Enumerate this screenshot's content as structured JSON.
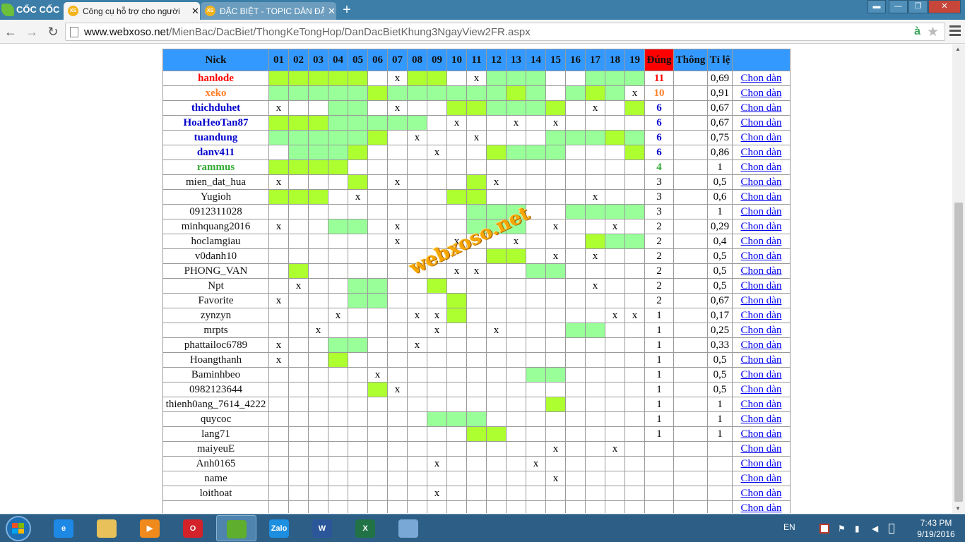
{
  "browser": {
    "brand": "CỐC CỐC",
    "tabs": [
      {
        "label": "Công cụ hỗ trợ cho người",
        "favicon": "XS"
      },
      {
        "label": "ĐẶC BIỆT - TOPIC DÀN ĐẶ",
        "favicon": "XS"
      }
    ],
    "new_tab": "+",
    "url_host": "www.webxoso.net",
    "url_path": "/MienBac/DacBiet/ThongKeTongHop/DanDacBietKhung3NgayView2FR.aspx"
  },
  "table": {
    "headers": {
      "nick": "Nick",
      "days": [
        "01",
        "02",
        "03",
        "04",
        "05",
        "06",
        "07",
        "08",
        "09",
        "10",
        "11",
        "12",
        "13",
        "14",
        "15",
        "16",
        "17",
        "18",
        "19"
      ],
      "dung": "Đúng",
      "thong": "Thông",
      "tile": "Tỉ lệ"
    },
    "link_label": "Chon dàn",
    "rows": [
      {
        "nick": "hanlode",
        "color": "#ff0000",
        "cells": "bbbbb.xbb.xaaa..aaaaa",
        "dung": "11",
        "tile": "0,69"
      },
      {
        "nick": "xeko",
        "color": "#ff7f27",
        "cells": "aaaaabaaaaaaba.abax..",
        "dung": "10",
        "tile": "0,91"
      },
      {
        "nick": "thichduhet",
        "color": "#0000cc",
        "cells": "x..aa.x..bbaaab.x.bb",
        "dung": "6",
        "tile": "0,67"
      },
      {
        "nick": "HoaHeoTan87",
        "color": "#0000cc",
        "cells": "bbbaaaaa.x..x.x......",
        "dung": "6",
        "tile": "0,67"
      },
      {
        "nick": "tuandung",
        "color": "#0000cc",
        "cells": "aaaaab.x..x...aaabaaa",
        "dung": "6",
        "tile": "0,75"
      },
      {
        "nick": "danv411",
        "color": "#0000cc",
        "cells": ".aaab...x..baaa...bb.",
        "dung": "6",
        "tile": "0,86"
      },
      {
        "nick": "rammus",
        "color": "#33aa33",
        "cells": "bbbb...............",
        "dung": "4",
        "tile": "1"
      },
      {
        "nick": "mien_dat_hua",
        "color": "#111111",
        "cells": "x...b.x...bx.........",
        "dung": "3",
        "tile": "0,5"
      },
      {
        "nick": "Yugioh",
        "color": "#111111",
        "cells": "bbb.x....bb.....x....",
        "dung": "3",
        "tile": "0,6"
      },
      {
        "nick": "0912311028",
        "color": "#111111",
        "cells": "..........aaa..aaaaa",
        "dung": "3",
        "tile": "1"
      },
      {
        "nick": "minhquang2016",
        "color": "#111111",
        "cells": "x..aa.x...aaa.x..x.x.",
        "dung": "2",
        "tile": "0,29"
      },
      {
        "nick": "hoclamgiau",
        "color": "#111111",
        "cells": "......x..x..x...baa..",
        "dung": "2",
        "tile": "0,4"
      },
      {
        "nick": "v0danh10",
        "color": "#111111",
        "cells": "...........bb.x.x....",
        "dung": "2",
        "tile": "0,5"
      },
      {
        "nick": "PHONG_VAN",
        "color": "#111111",
        "cells": ".b.......xx..aa......",
        "dung": "2",
        "tile": "0,5"
      },
      {
        "nick": "Npt",
        "color": "#111111",
        "cells": ".x..aa..b.......x....",
        "dung": "2",
        "tile": "0,5"
      },
      {
        "nick": "Favorite",
        "color": "#111111",
        "cells": "x...aa...b.........",
        "dung": "2",
        "tile": "0,67"
      },
      {
        "nick": "zynzyn",
        "color": "#111111",
        "cells": "...x...xxb.......xx",
        "dung": "1",
        "tile": "0,17"
      },
      {
        "nick": "mrpts",
        "color": "#111111",
        "cells": "..x.....x..x...aa....",
        "dung": "1",
        "tile": "0,25"
      },
      {
        "nick": "phattailoc6789",
        "color": "#111111",
        "cells": "x..aa..x...........",
        "dung": "1",
        "tile": "0,33"
      },
      {
        "nick": "Hoangthanh",
        "color": "#111111",
        "cells": "x..b...............",
        "dung": "1",
        "tile": "0,5"
      },
      {
        "nick": "Baminhbeo",
        "color": "#111111",
        "cells": ".....x.......aa....",
        "dung": "1",
        "tile": "0,5"
      },
      {
        "nick": "0982123644",
        "color": "#111111",
        "cells": ".....bx............",
        "dung": "1",
        "tile": "0,5"
      },
      {
        "nick": "thienh0ang_7614_4222",
        "color": "#111111",
        "cells": "..............b....",
        "dung": "1",
        "tile": "1"
      },
      {
        "nick": "quycoc",
        "color": "#111111",
        "cells": "........aaa........",
        "dung": "1",
        "tile": "1"
      },
      {
        "nick": "lang71",
        "color": "#111111",
        "cells": "..........bb.......",
        "dung": "1",
        "tile": "1"
      },
      {
        "nick": "maiyeuE",
        "color": "#111111",
        "cells": "..............x..x.",
        "dung": "",
        "tile": ""
      },
      {
        "nick": "Anh0165",
        "color": "#111111",
        "cells": "........x....x.....",
        "dung": "",
        "tile": ""
      },
      {
        "nick": "name",
        "color": "#111111",
        "cells": "..............x....",
        "dung": "",
        "tile": ""
      },
      {
        "nick": "loithoat",
        "color": "#111111",
        "cells": "........x..........",
        "dung": "",
        "tile": ""
      },
      {
        "nick": "",
        "color": "#111111",
        "cells": "...................",
        "dung": "",
        "tile": ""
      }
    ],
    "cell_colors": {
      "a": "#99ff99",
      "b": "#adff2f"
    }
  },
  "watermark": "webxoso.net",
  "taskbar": {
    "apps": [
      {
        "name": "internet-explorer",
        "label": "e",
        "color": "#1e88e5"
      },
      {
        "name": "file-explorer",
        "label": "",
        "color": "#e8c15a"
      },
      {
        "name": "media-player",
        "label": "▶",
        "color": "#f08a1c"
      },
      {
        "name": "opera",
        "label": "O",
        "color": "#d3222a"
      },
      {
        "name": "coccoc",
        "label": "",
        "color": "#5fae2e"
      },
      {
        "name": "zalo",
        "label": "Zalo",
        "color": "#1d8fe1"
      },
      {
        "name": "word",
        "label": "W",
        "color": "#2b579a"
      },
      {
        "name": "excel",
        "label": "X",
        "color": "#217346"
      },
      {
        "name": "paint",
        "label": "",
        "color": "#7aa8d6"
      }
    ],
    "lang": "EN",
    "time": "7:43 PM",
    "date": "9/19/2016"
  }
}
